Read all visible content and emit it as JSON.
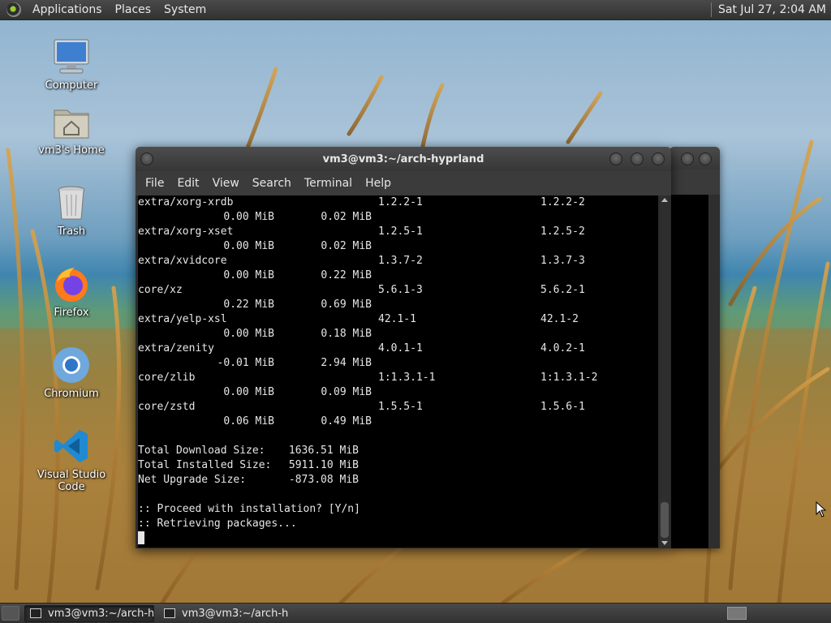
{
  "top_panel": {
    "menus": [
      "Applications",
      "Places",
      "System"
    ],
    "clock": "Sat Jul 27,  2:04 AM"
  },
  "desktop_icons": [
    {
      "label": "Computer",
      "icon": "computer-icon"
    },
    {
      "label": "vm3's Home",
      "icon": "home-folder-icon"
    },
    {
      "label": "Trash",
      "icon": "trash-icon"
    },
    {
      "label": "Firefox",
      "icon": "firefox-icon"
    },
    {
      "label": "Chromium",
      "icon": "chromium-icon"
    },
    {
      "label": "Visual Studio Code",
      "icon": "vscode-icon"
    }
  ],
  "terminal": {
    "title": "vm3@vm3:~/arch-hyprland",
    "menus": [
      "File",
      "Edit",
      "View",
      "Search",
      "Terminal",
      "Help"
    ],
    "packages": [
      {
        "name": "extra/xorg-xrdb",
        "old": "1.2.2-1",
        "new": "1.2.2-2",
        "net": "0.00 MiB",
        "dl": "0.02 MiB"
      },
      {
        "name": "extra/xorg-xset",
        "old": "1.2.5-1",
        "new": "1.2.5-2",
        "net": "0.00 MiB",
        "dl": "0.02 MiB"
      },
      {
        "name": "extra/xvidcore",
        "old": "1.3.7-2",
        "new": "1.3.7-3",
        "net": "0.00 MiB",
        "dl": "0.22 MiB"
      },
      {
        "name": "core/xz",
        "old": "5.6.1-3",
        "new": "5.6.2-1",
        "net": "0.22 MiB",
        "dl": "0.69 MiB"
      },
      {
        "name": "extra/yelp-xsl",
        "old": "42.1-1",
        "new": "42.1-2",
        "net": "0.00 MiB",
        "dl": "0.18 MiB"
      },
      {
        "name": "extra/zenity",
        "old": "4.0.1-1",
        "new": "4.0.2-1",
        "net": "-0.01 MiB",
        "dl": "2.94 MiB"
      },
      {
        "name": "core/zlib",
        "old": "1:1.3.1-1",
        "new": "1:1.3.1-2",
        "net": "0.00 MiB",
        "dl": "0.09 MiB"
      },
      {
        "name": "core/zstd",
        "old": "1.5.5-1",
        "new": "1.5.6-1",
        "net": "0.06 MiB",
        "dl": "0.49 MiB"
      }
    ],
    "totals": [
      {
        "label": "Total Download Size:",
        "value": "1636.51 MiB"
      },
      {
        "label": "Total Installed Size:",
        "value": "5911.10 MiB"
      },
      {
        "label": "Net Upgrade Size:",
        "value": "-873.08 MiB"
      }
    ],
    "prompt_lines": [
      ":: Proceed with installation? [Y/n]",
      ":: Retrieving packages..."
    ]
  },
  "taskbar": {
    "tasks": [
      {
        "label": "vm3@vm3:~/arch-h...",
        "active": true
      },
      {
        "label": "vm3@vm3:~/arch-h...",
        "active": false
      }
    ]
  }
}
